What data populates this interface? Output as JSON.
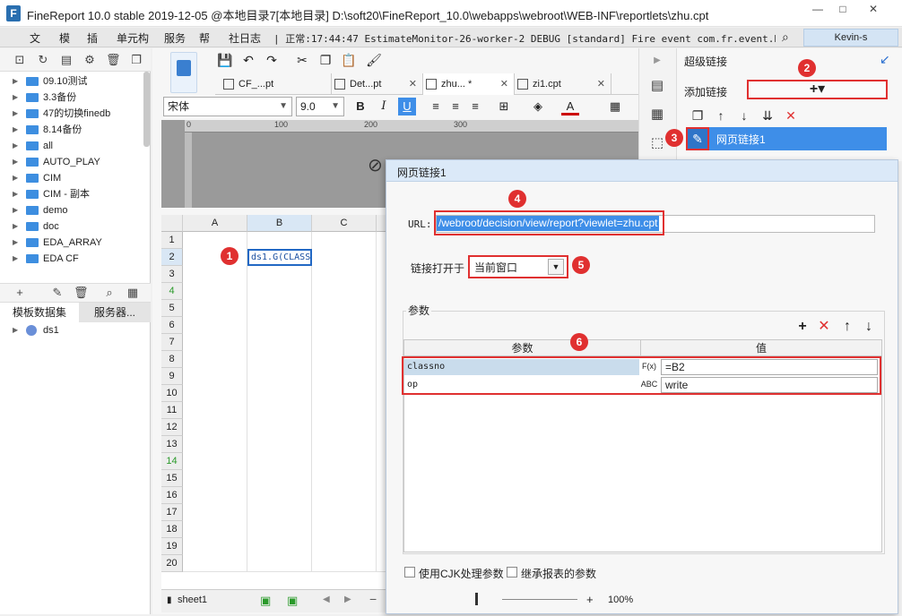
{
  "window": {
    "logo_letter": "F",
    "title": "FineReport 10.0 stable 2019-12-05 @本地目录7[本地目录]    D:\\soft20\\FineReport_10.0\\webapps\\webroot\\WEB-INF\\reportlets\\zhu.cpt",
    "min_glyph": "—",
    "max_glyph": "□",
    "close_glyph": "✕"
  },
  "menu": {
    "items": [
      "文",
      "模",
      "插",
      "单元构",
      "服务",
      "帮",
      "社日志"
    ],
    "log_line": "| 正常:17:44:47 EstimateMonitor-26-worker-2 DEBUG [standard] Fire event com.fr.event.BaseEve...",
    "user": "Kevin-s"
  },
  "left_panel": {
    "tree": [
      {
        "label": "09.10测试"
      },
      {
        "label": "3.3备份"
      },
      {
        "label": "47的切换finedb"
      },
      {
        "label": "8.14备份"
      },
      {
        "label": "all"
      },
      {
        "label": "AUTO_PLAY"
      },
      {
        "label": "CIM"
      },
      {
        "label": "CIM - 副本"
      },
      {
        "label": "demo"
      },
      {
        "label": "doc"
      },
      {
        "label": "EDA_ARRAY"
      },
      {
        "label": "EDA CF"
      }
    ],
    "dataset_tabs": [
      "模板数据集",
      "服务器..."
    ],
    "datasets": [
      "ds1"
    ]
  },
  "editor": {
    "tabs": [
      {
        "label": "CF_...pt"
      },
      {
        "label": "Det...pt"
      },
      {
        "label": "zhu... *"
      },
      {
        "label": "zi1.cpt"
      }
    ],
    "font_name": "宋体",
    "font_size": "9.0",
    "bold": "B",
    "italic": "I",
    "underline": "U",
    "ruler_marks": [
      "0",
      "100",
      "200",
      "300"
    ],
    "columns": [
      "A",
      "B",
      "C"
    ],
    "rows": [
      "1",
      "2",
      "3",
      "4",
      "5",
      "6",
      "7",
      "8",
      "9",
      "10",
      "11",
      "12",
      "13",
      "14",
      "15",
      "16",
      "17",
      "18",
      "19",
      "20"
    ],
    "selected_cell_value": "ds1.G(CLASS",
    "sheet_name": "sheet1",
    "zoom": "100%"
  },
  "hyperlink_panel": {
    "title": "超级链接",
    "add_label": "添加链接",
    "add_glyph": "+▾",
    "selected_link": "网页链接1"
  },
  "dialog": {
    "title": "网页链接1",
    "url_label": "URL:",
    "url_value": "/webroot/decision/view/report?viewlet=zhu.cpt",
    "open_label": "链接打开于",
    "open_value": "当前窗口",
    "params_title": "参数",
    "col_param": "参数",
    "col_value": "值",
    "params": [
      {
        "name": "classno",
        "type_glyph": "F(x)",
        "value": "=B2"
      },
      {
        "name": "op",
        "type_glyph": "ABC",
        "value": "write"
      }
    ],
    "cjk_label": "使用CJK处理参数",
    "inherit_label": "继承报表的参数"
  },
  "callouts": [
    "1",
    "2",
    "3",
    "4",
    "5",
    "6"
  ],
  "colors": {
    "accent_blue": "#3e8ee8",
    "callout_red": "#e03030",
    "folder_blue": "#3d8ee0"
  }
}
